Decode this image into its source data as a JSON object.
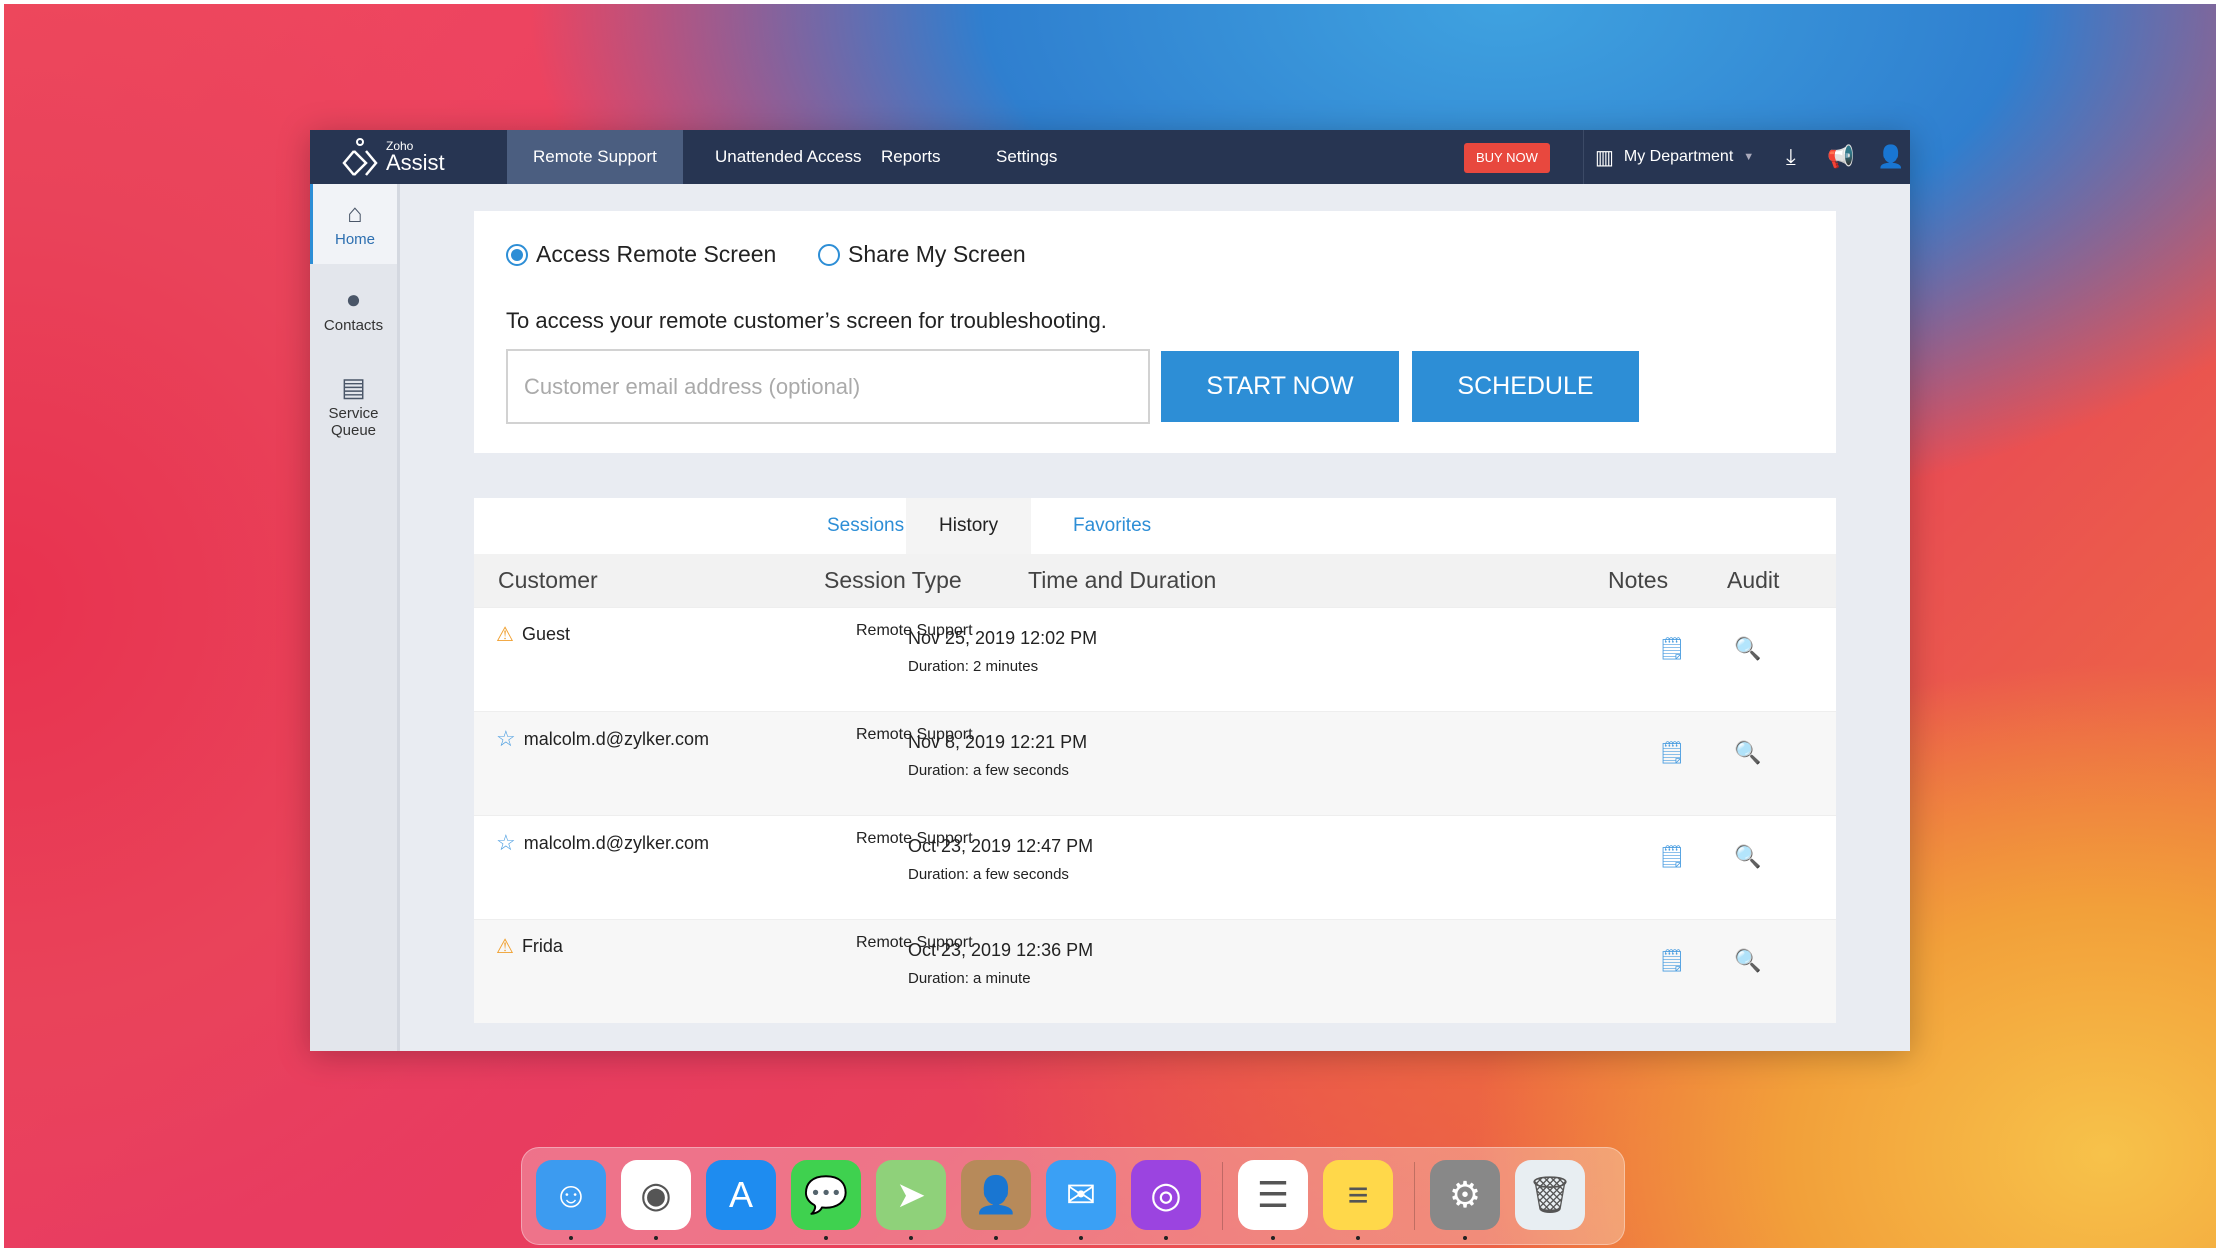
{
  "header": {
    "logo_small": "Zoho",
    "logo_large": "Assist",
    "nav": [
      "Remote Support",
      "Unattended Access",
      "Reports",
      "Settings"
    ],
    "active_nav": "Remote Support",
    "buy_now": "BUY NOW",
    "department": "My Department"
  },
  "sidebar": {
    "items": [
      {
        "label": "Home",
        "icon": "home-icon"
      },
      {
        "label": "Contacts",
        "icon": "contact-icon"
      },
      {
        "label": "Service Queue",
        "icon": "queue-icon"
      }
    ]
  },
  "start": {
    "options": [
      "Access Remote Screen",
      "Share My Screen"
    ],
    "selected": "Access Remote Screen",
    "description": "To access your remote customer’s screen for troubleshooting.",
    "email_placeholder": "Customer email address (optional)",
    "start_label": "START NOW",
    "schedule_label": "SCHEDULE"
  },
  "history": {
    "tabs": [
      "Sessions",
      "History",
      "Favorites"
    ],
    "active_tab": "History",
    "columns": [
      "Customer",
      "Session Type",
      "Time and Duration",
      "Notes",
      "Audit"
    ],
    "rows": [
      {
        "customer": "Guest",
        "icon": "warning-icon",
        "type": "Remote Support",
        "time": "Nov 25, 2019 12:02 PM",
        "duration": "Duration: 2 minutes"
      },
      {
        "customer": "malcolm.d@zylker.com",
        "icon": "star-icon",
        "type": "Remote Support",
        "time": "Nov 8, 2019 12:21 PM",
        "duration": "Duration: a few seconds"
      },
      {
        "customer": "malcolm.d@zylker.com",
        "icon": "star-icon",
        "type": "Remote Support",
        "time": "Oct 23, 2019 12:47 PM",
        "duration": "Duration: a few seconds"
      },
      {
        "customer": "Frida",
        "icon": "warning-icon",
        "type": "Remote Support",
        "time": "Oct 23, 2019 12:36 PM",
        "duration": "Duration: a minute"
      }
    ]
  },
  "colors": {
    "header": "#273552",
    "accent": "#2d8ed6",
    "buy_now": "#e8483e"
  },
  "dock": [
    "finder",
    "chrome",
    "app-store",
    "messages",
    "maps",
    "contacts",
    "mail",
    "podcasts",
    "reminders",
    "notes",
    "system-preferences",
    "trash"
  ]
}
